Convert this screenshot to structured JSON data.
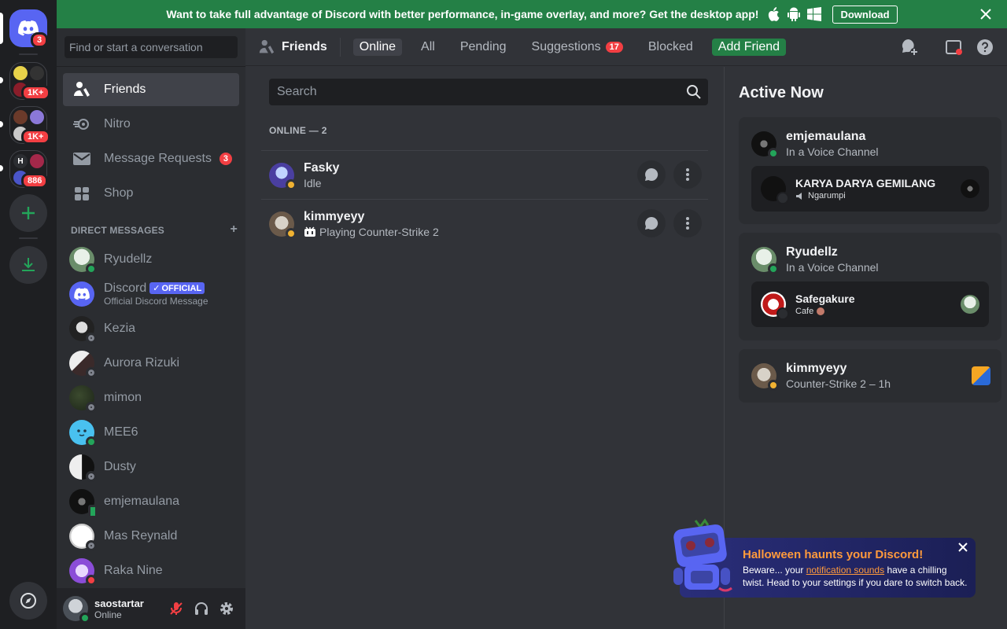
{
  "banner": {
    "text": "Want to take full advantage of Discord with better performance, in-game overlay, and more? Get the desktop app!",
    "download_label": "Download"
  },
  "guilds": {
    "home_badge": "3",
    "servers": [
      {
        "badge": "1K+"
      },
      {
        "badge": "1K+"
      },
      {
        "badge": "886",
        "letter": "H"
      }
    ]
  },
  "sidebar": {
    "search_placeholder": "Find or start a conversation",
    "nav": [
      {
        "label": "Friends",
        "icon": "friends-icon"
      },
      {
        "label": "Nitro",
        "icon": "nitro-icon"
      },
      {
        "label": "Message Requests",
        "icon": "mail-icon",
        "badge": "3"
      },
      {
        "label": "Shop",
        "icon": "shop-icon"
      }
    ],
    "dm_header": "DIRECT MESSAGES",
    "dm_add": "+",
    "dms": [
      {
        "name": "Ryudellz",
        "status": "online"
      },
      {
        "name": "Discord",
        "sub": "Official Discord Message",
        "badge": "OFFICIAL"
      },
      {
        "name": "Kezia",
        "status": "offline"
      },
      {
        "name": "Aurora Rizuki",
        "status": "offline"
      },
      {
        "name": "mimon",
        "status": "offline"
      },
      {
        "name": "MEE6",
        "status": "online"
      },
      {
        "name": "Dusty",
        "status": "offline"
      },
      {
        "name": "emjemaulana",
        "status": "mobile"
      },
      {
        "name": "Mas Reynald",
        "status": "offline"
      },
      {
        "name": "Raka Nine",
        "status": "dnd"
      }
    ]
  },
  "user": {
    "name": "saostartar",
    "status": "Online"
  },
  "topbar": {
    "title": "Friends",
    "tabs": [
      {
        "label": "Online"
      },
      {
        "label": "All"
      },
      {
        "label": "Pending"
      },
      {
        "label": "Suggestions",
        "badge": "17"
      },
      {
        "label": "Blocked"
      }
    ],
    "add_friend": "Add Friend"
  },
  "friends": {
    "search_placeholder": "Search",
    "header": "ONLINE — 2",
    "list": [
      {
        "name": "Fasky",
        "status_text": "Idle"
      },
      {
        "name": "kimmyeyy",
        "status_text": "Playing Counter-Strike 2"
      }
    ]
  },
  "active_now": {
    "title": "Active Now",
    "cards": [
      {
        "name": "emjemaulana",
        "sub": "In a Voice Channel",
        "server": "KARYA DARYA GEMILANG",
        "channel": "Ngarumpi"
      },
      {
        "name": "Ryudellz",
        "sub": "In a Voice Channel",
        "server": "Safegakure",
        "channel": "Cafe"
      },
      {
        "name": "kimmyeyy",
        "sub": "Counter-Strike 2 – 1h"
      }
    ]
  },
  "toast": {
    "title": "Halloween haunts your Discord!",
    "body_pre": "Beware... your ",
    "body_link": "notification sounds",
    "body_post": " have a chilling twist. Head to your settings if you dare to switch back."
  },
  "colors": {
    "brand": "#5865f2",
    "green": "#248046",
    "red": "#f23f43",
    "bg": "#313338"
  }
}
